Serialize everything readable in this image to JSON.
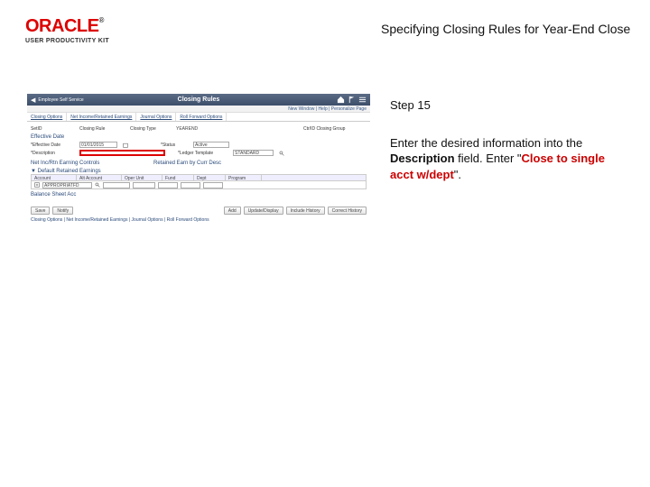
{
  "brand": {
    "name": "ORACLE",
    "tm": "®",
    "sub": "USER PRODUCTIVITY KIT"
  },
  "title": "Specifying Closing Rules for Year-End Close",
  "step": "Step 15",
  "instruction": {
    "pre": "Enter the desired information into the ",
    "bold1": "Description",
    "mid": " field. Enter \"",
    "red": "Close to single acct w/dept",
    "post": "\"."
  },
  "ss": {
    "back": "Employee Self Service",
    "heading": "Closing Rules",
    "subline": "New Window | Help | Personalize Page",
    "tabs": [
      "Closing Options",
      "Net Income/Retained Earnings",
      "Journal Options",
      "Roll Forward Options"
    ],
    "row1": {
      "setid_label": "SetID",
      "setid_val": "",
      "closing_rule_label": "Closing Rule",
      "closing_rule_val": "",
      "closing_type_label": "Closing Type",
      "closing_type_val": "YEAREND",
      "group_label": "Ctr/ID Closing Group"
    },
    "section1": "Effective Date",
    "row2": {
      "eff_date_label": "*Effective Date",
      "eff_date_val": "01/01/2015",
      "status_label": "*Status",
      "status_val": "Active"
    },
    "row3": {
      "desc_label": "*Description",
      "tmpl_label": "*Ledger Template",
      "tmpl_val": "STANDARD"
    },
    "section2": "Net Inc/Rtn Earning Controls",
    "section2b": "Retained Earn by Curr Desc",
    "grid_title": "Default Retained Earnings",
    "grid_cols": [
      "Account",
      "Alt Account",
      "Oper Unit",
      "Fund",
      "Dept",
      "Program"
    ],
    "grid_input": "APPROPRIATFD",
    "section3": "Balance Sheet Acc",
    "buttons": [
      "Save",
      "Notify"
    ],
    "buttons2": [
      "Add",
      "Update/Display",
      "Include History",
      "Correct History"
    ],
    "footer": "Closing Options | Net Income/Retained Earnings | Journal Options | Roll Forward Options"
  }
}
